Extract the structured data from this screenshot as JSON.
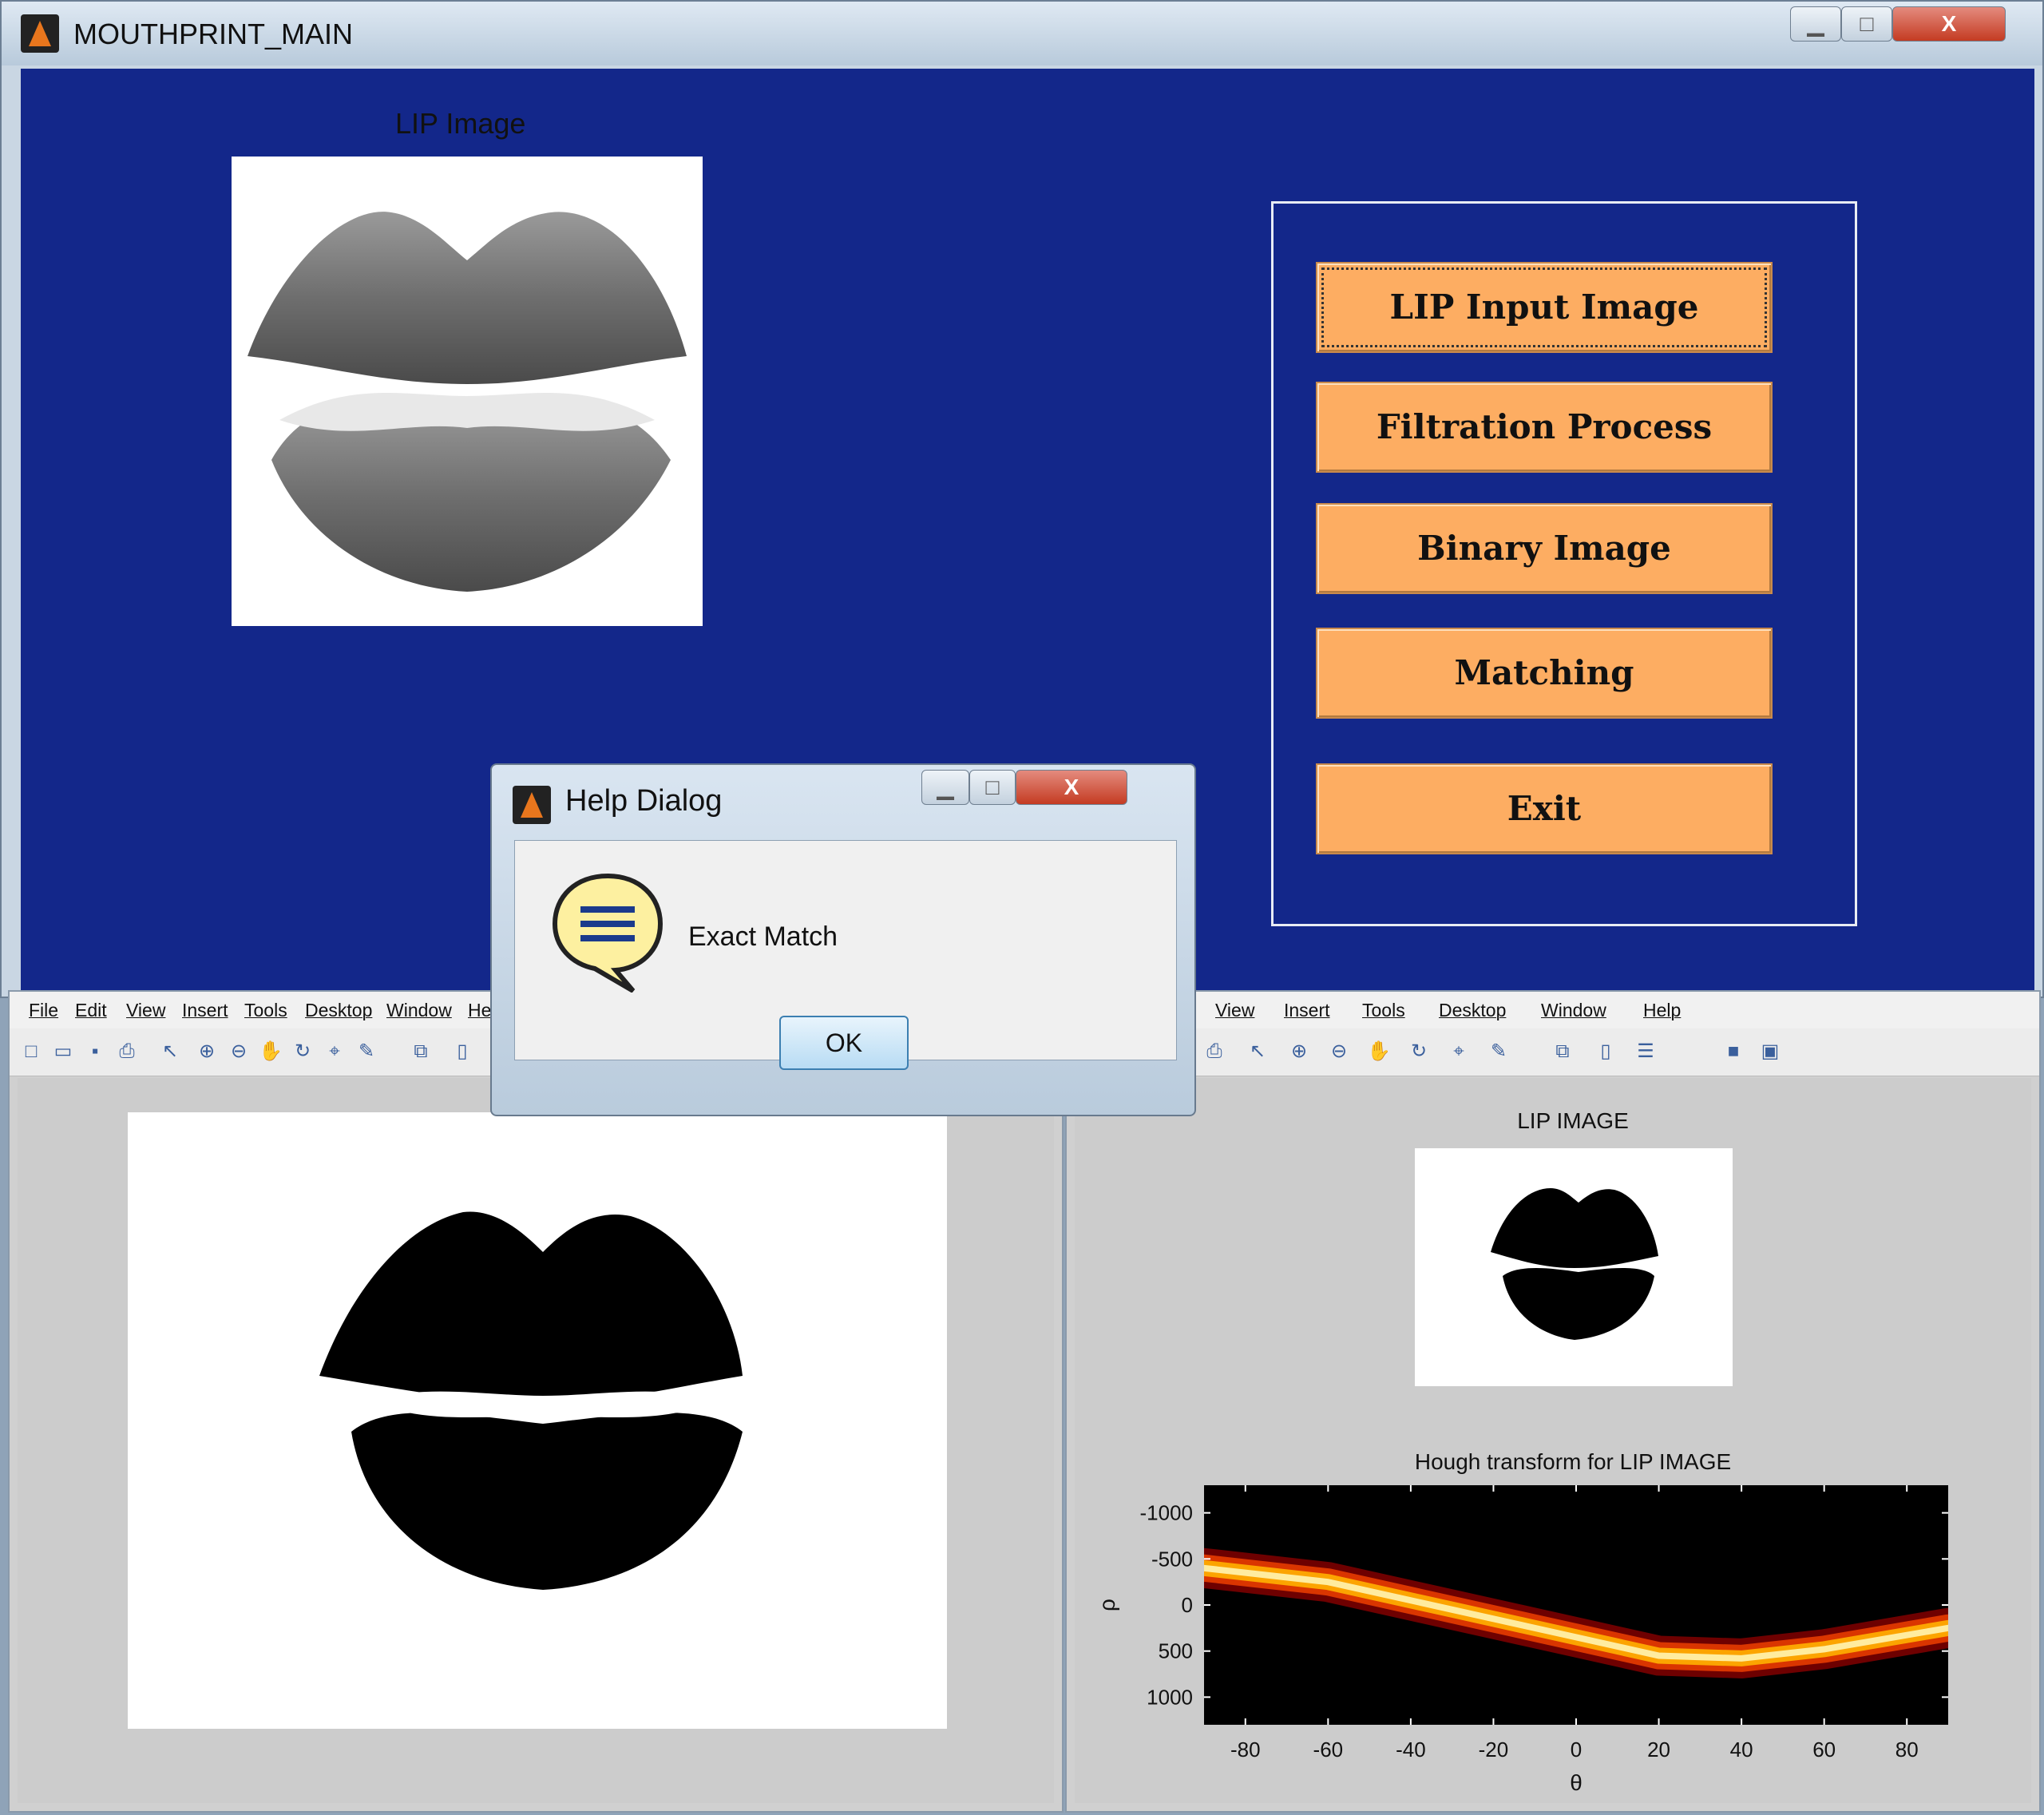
{
  "main_window": {
    "title": "MOUTHPRINT_MAIN",
    "controls": {
      "minimize": "▁",
      "maximize": "□",
      "close": "X"
    }
  },
  "lip_panel": {
    "title": "LIP Image"
  },
  "buttons": {
    "lip_input": "LIP Input Image",
    "filtration": "Filtration Process",
    "binary": "Binary Image",
    "matching": "Matching",
    "exit": "Exit"
  },
  "left_figure": {
    "menu": [
      "File",
      "Edit",
      "View",
      "Insert",
      "Tools",
      "Desktop",
      "Window",
      "He"
    ]
  },
  "right_figure": {
    "menu": [
      "View",
      "Insert",
      "Tools",
      "Desktop",
      "Window",
      "Help"
    ],
    "small_image_title": "LIP IMAGE",
    "hough_title": "Hough transform for LIP IMAGE"
  },
  "help_dialog": {
    "title": "Help Dialog",
    "message": "Exact Match",
    "ok_label": "OK",
    "controls": {
      "minimize": "▁",
      "maximize": "□",
      "close": "X"
    }
  },
  "chart_data": {
    "type": "heatmap",
    "title": "Hough transform for LIP IMAGE",
    "xlabel": "θ",
    "ylabel": "ρ",
    "xlim": [
      -90,
      90
    ],
    "ylim": [
      1300,
      -1300
    ],
    "x_ticks": [
      -80,
      -60,
      -40,
      -20,
      0,
      20,
      40,
      60,
      80
    ],
    "y_ticks": [
      -1000,
      -500,
      0,
      500,
      1000
    ],
    "band_center": {
      "theta": [
        -90,
        -60,
        -30,
        0,
        20,
        40,
        60,
        90
      ],
      "rho": [
        -400,
        -250,
        50,
        350,
        550,
        580,
        480,
        250
      ]
    },
    "colormap": [
      "#000000",
      "#7a0000",
      "#e53b00",
      "#ffb000",
      "#fff4b0"
    ]
  }
}
